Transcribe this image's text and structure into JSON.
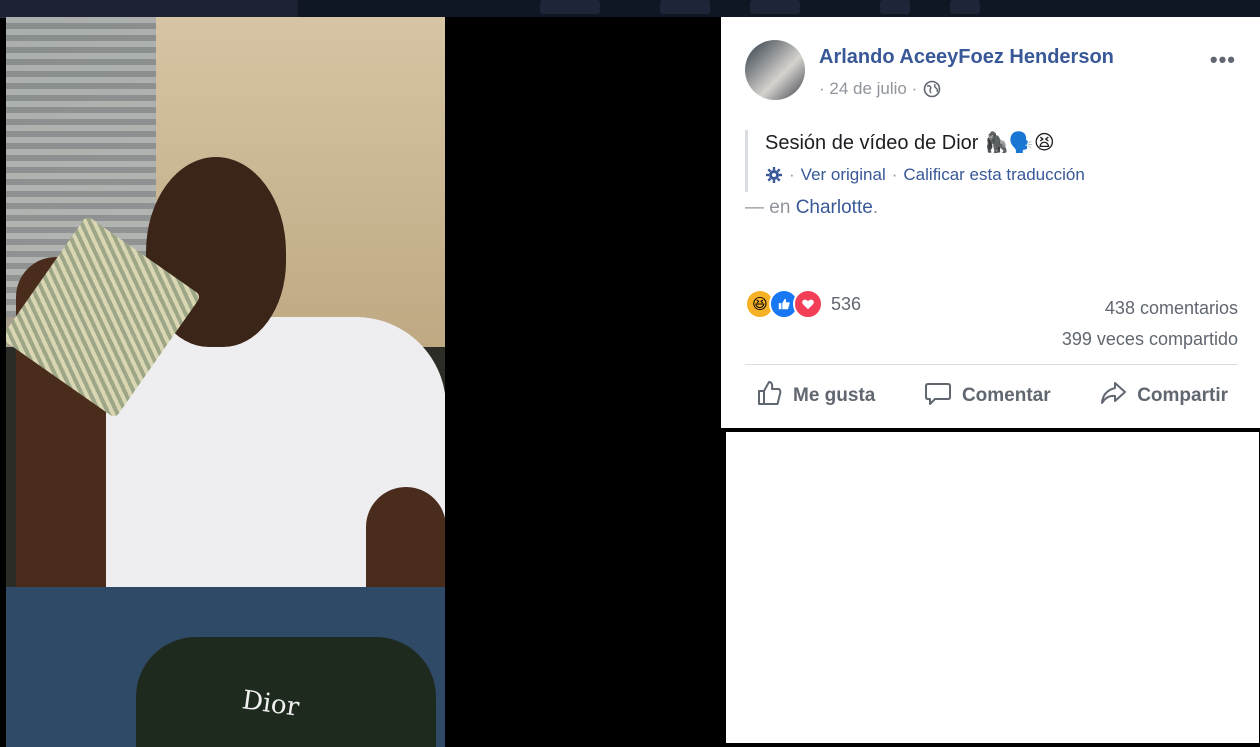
{
  "post": {
    "author": "Arlando AceeyFoez Henderson",
    "date": "· 24 de julio ·",
    "more_label": "•••",
    "text": "Sesión de vídeo de Dior 🦍🗣️😫",
    "see_original": "Ver original",
    "separator": "·",
    "rate_translation": "Calificar esta traducción",
    "location_prefix": "— en",
    "location": "Charlotte",
    "location_suffix": ".",
    "reaction_count": "536",
    "comments": "438 comentarios",
    "shares": "399 veces compartido",
    "actions": {
      "like": "Me gusta",
      "comment": "Comentar",
      "share": "Compartir"
    }
  },
  "photo": {
    "brand_text": "Dior"
  },
  "colors": {
    "link": "#385898",
    "muted": "#90949c",
    "action": "#606770"
  }
}
